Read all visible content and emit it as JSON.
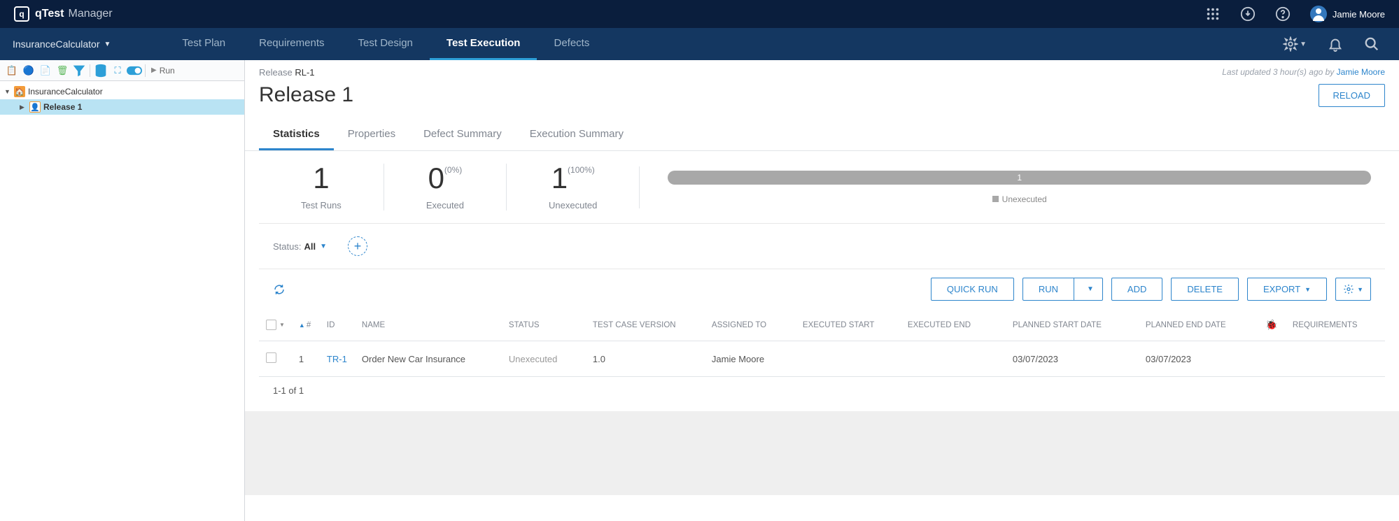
{
  "header": {
    "logo_brand": "qTest",
    "logo_product": "Manager",
    "user_name": "Jamie Moore"
  },
  "nav": {
    "project_name": "InsuranceCalculator",
    "tabs": [
      "Test Plan",
      "Requirements",
      "Test Design",
      "Test Execution",
      "Defects"
    ],
    "active_tab": "Test Execution"
  },
  "sidebar": {
    "run_label": "Run",
    "tree": {
      "root": "InsuranceCalculator",
      "child": "Release 1"
    }
  },
  "release": {
    "crumb_label": "Release",
    "crumb_id": "RL-1",
    "last_updated_prefix": "Last updated 3 hour(s) ago by ",
    "last_updated_user": "Jamie Moore",
    "title": "Release 1",
    "reload_label": "RELOAD"
  },
  "sub_tabs": [
    "Statistics",
    "Properties",
    "Defect Summary",
    "Execution Summary"
  ],
  "stats": {
    "test_runs": {
      "value": "1",
      "label": "Test Runs"
    },
    "executed": {
      "value": "0",
      "pct": "(0%)",
      "label": "Executed"
    },
    "unexecuted": {
      "value": "1",
      "pct": "(100%)",
      "label": "Unexecuted"
    },
    "bar_value": "1",
    "legend": "Unexecuted"
  },
  "status_filter": {
    "label": "Status:",
    "value": "All"
  },
  "actions": {
    "quick_run": "QUICK RUN",
    "run": "RUN",
    "add": "ADD",
    "delete": "DELETE",
    "export": "EXPORT"
  },
  "table": {
    "headers": {
      "num": "#",
      "id": "ID",
      "name": "NAME",
      "status": "STATUS",
      "tcv": "TEST CASE VERSION",
      "assigned": "ASSIGNED TO",
      "exec_start": "EXECUTED START",
      "exec_end": "EXECUTED END",
      "plan_start": "PLANNED START DATE",
      "plan_end": "PLANNED END DATE",
      "req": "REQUIREMENTS"
    },
    "rows": [
      {
        "num": "1",
        "id": "TR-1",
        "name": "Order New Car Insurance",
        "status": "Unexecuted",
        "tcv": "1.0",
        "assigned": "Jamie Moore",
        "exec_start": "",
        "exec_end": "",
        "plan_start": "03/07/2023",
        "plan_end": "03/07/2023",
        "req": ""
      }
    ]
  },
  "pagination": "1-1 of 1"
}
